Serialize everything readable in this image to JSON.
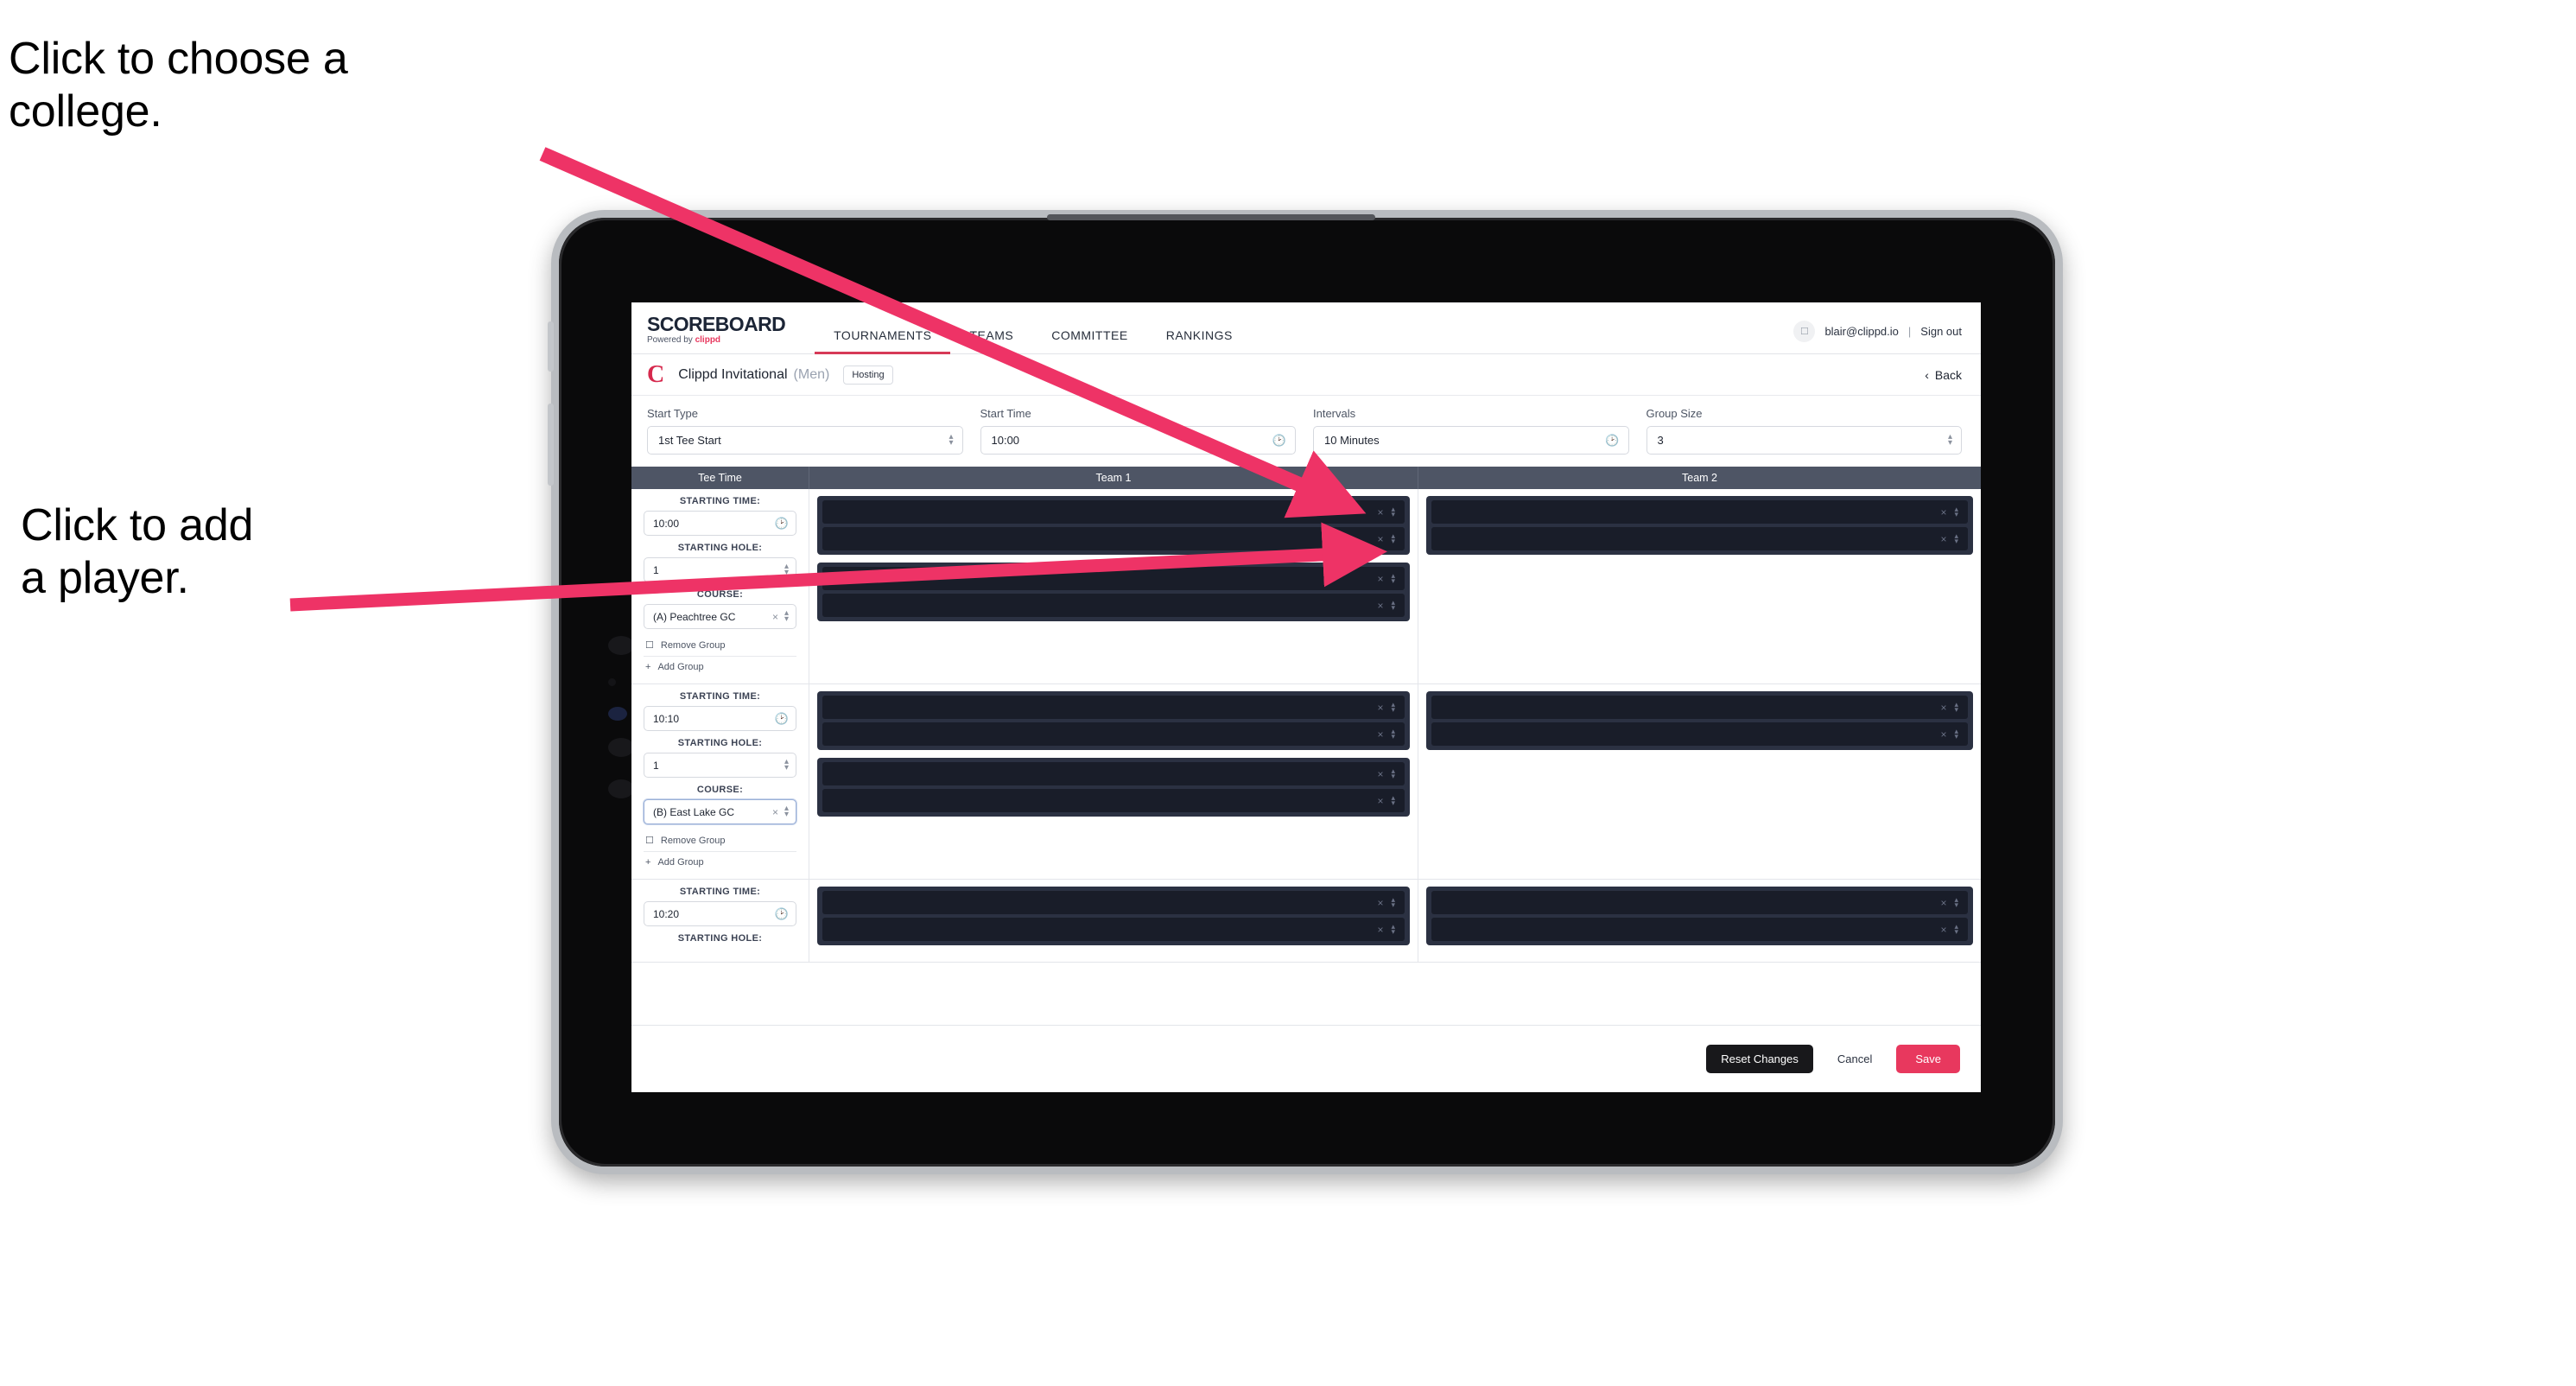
{
  "annotations": {
    "college": "Click to choose a\ncollege.",
    "player": "Click to add\na player."
  },
  "colors": {
    "accent_pink": "#e8385e",
    "brand_red": "#d6294d",
    "table_header": "#4e5565",
    "row_dark": "#191d29",
    "group_box": "#2b3142"
  },
  "nav": {
    "brand_title": "SCOREBOARD",
    "brand_sub_prefix": "Powered by ",
    "brand_sub_name": "clippd",
    "tabs": [
      {
        "label": "TOURNAMENTS",
        "active": true
      },
      {
        "label": "TEAMS",
        "active": false
      },
      {
        "label": "COMMITTEE",
        "active": false
      },
      {
        "label": "RANKINGS",
        "active": false
      }
    ],
    "avatar_icon": "user-avatar-icon",
    "user_email": "blair@clippd.io",
    "separator": "|",
    "sign_out": "Sign out"
  },
  "tournament": {
    "logo_letter": "C",
    "name": "Clippd Invitational",
    "gender": "(Men)",
    "badge": "Hosting",
    "back_label": "Back",
    "back_icon": "chevron-left-icon"
  },
  "controls": [
    {
      "label": "Start Type",
      "value": "1st Tee Start",
      "icon": "stepper-icon"
    },
    {
      "label": "Start Time",
      "value": "10:00",
      "icon": "clock-icon"
    },
    {
      "label": "Intervals",
      "value": "10 Minutes",
      "icon": "clock-icon"
    },
    {
      "label": "Group Size",
      "value": "3",
      "icon": "stepper-icon"
    }
  ],
  "table": {
    "columns": [
      "Tee Time",
      "Team 1",
      "Team 2"
    ],
    "field_labels": {
      "starting_time": "STARTING TIME:",
      "starting_hole": "STARTING HOLE:",
      "course": "COURSE:"
    },
    "group_actions": {
      "remove": "Remove Group",
      "remove_icon": "trash-icon",
      "add": "Add Group",
      "add_icon": "plus-icon"
    },
    "rows": [
      {
        "starting_time": "10:00",
        "starting_hole": "1",
        "course": "(A) Peachtree GC",
        "course_focused": false,
        "team1_groups": [
          2,
          2
        ],
        "team2_groups": [
          2
        ]
      },
      {
        "starting_time": "10:10",
        "starting_hole": "1",
        "course": "(B) East Lake GC",
        "course_focused": true,
        "team1_groups": [
          2,
          2
        ],
        "team2_groups": [
          2
        ]
      },
      {
        "starting_time": "10:20",
        "starting_hole": "",
        "course": "",
        "course_focused": false,
        "team1_groups": [
          2
        ],
        "team2_groups": [
          2
        ]
      }
    ]
  },
  "footer": {
    "reset": "Reset Changes",
    "cancel": "Cancel",
    "save": "Save"
  }
}
